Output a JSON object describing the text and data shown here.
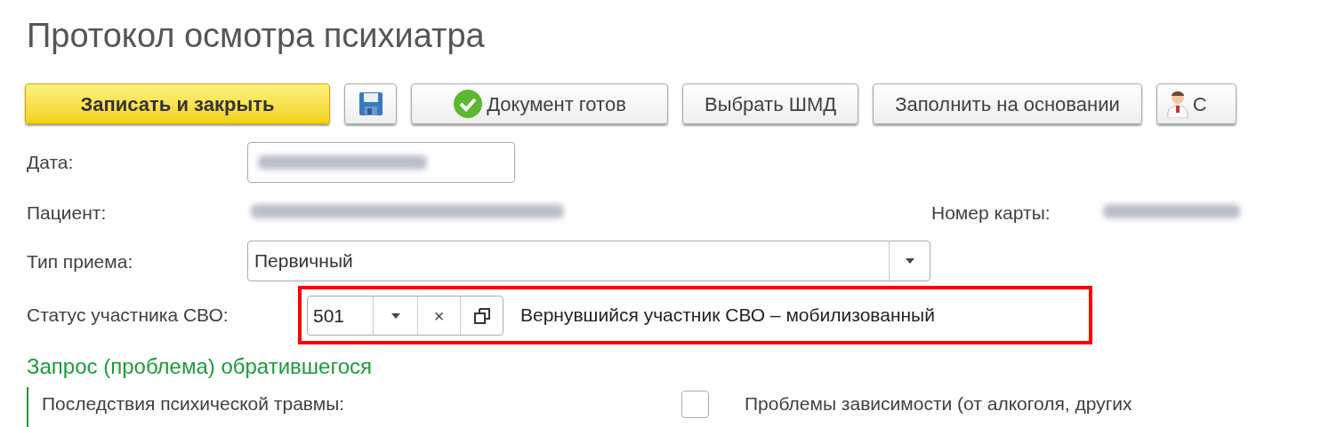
{
  "title": "Протокол осмотра психиатра",
  "toolbar": [
    {
      "kind": "primary",
      "label": "Записать и закрыть"
    },
    {
      "kind": "save"
    },
    {
      "kind": "check",
      "label": "Документ готов"
    },
    {
      "kind": "plain",
      "label": "Выбрать ШМД"
    },
    {
      "kind": "plain",
      "label": "Заполнить на основании"
    },
    {
      "kind": "person",
      "label": "С"
    }
  ],
  "date": {
    "label": "Дата:"
  },
  "patient": {
    "label": "Пациент:",
    "card_label": "Номер карты:"
  },
  "visit_type": {
    "label": "Тип приема:",
    "value": "Первичный"
  },
  "svo_status": {
    "label": "Статус участника СВО:",
    "code": "501",
    "clear": "×",
    "description": "Вернувшийся участник СВО – мобилизованный",
    "highlighted": true
  },
  "section": {
    "title": "Запрос (проблема) обратившегося",
    "items": [
      {
        "label": "Последствия психической травмы:"
      },
      {
        "label": "Проблемы зависимости (от алкоголя, других",
        "checked": false
      }
    ]
  }
}
